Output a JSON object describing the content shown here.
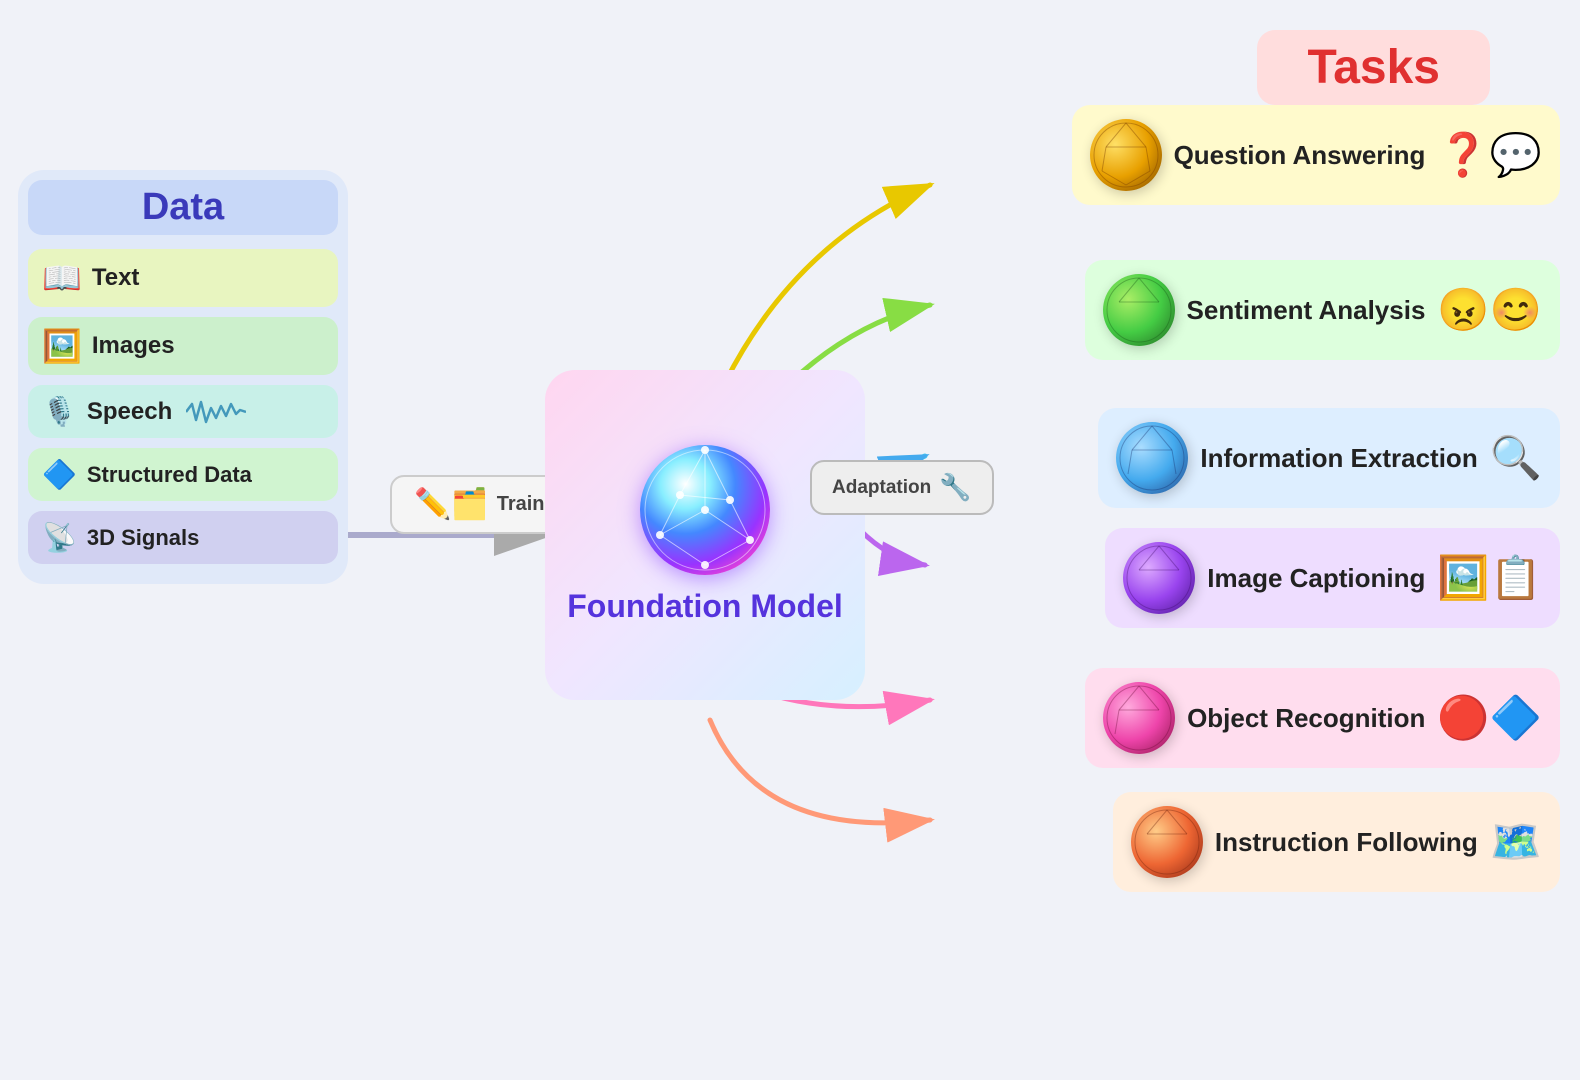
{
  "data_section": {
    "title": "Data",
    "items": [
      {
        "id": "text",
        "label": "Text",
        "emoji": "📖",
        "color": "text-item"
      },
      {
        "id": "images",
        "label": "Images",
        "emoji": "🖼️",
        "color": "images-item"
      },
      {
        "id": "speech",
        "label": "Speech",
        "emoji": "🎤",
        "color": "speech-item"
      },
      {
        "id": "structured",
        "label": "Structured Data",
        "emoji": "🔷",
        "color": "struct-item"
      },
      {
        "id": "signals",
        "label": "3D Signals",
        "emoji": "📡",
        "color": "signals-item"
      }
    ]
  },
  "training": {
    "label": "Training",
    "emoji": "✏️"
  },
  "foundation": {
    "title": "Foundation Model"
  },
  "adaptation": {
    "label": "Adaptation",
    "emoji": "🔧"
  },
  "tasks": {
    "header": "Tasks",
    "cards": [
      {
        "id": "qa",
        "label": "Question Answering",
        "ball": "gold",
        "icon": "💬",
        "card_class": "card-qa"
      },
      {
        "id": "sentiment",
        "label": "Sentiment Analysis",
        "ball": "green",
        "icon": "😊",
        "card_class": "card-sentiment"
      },
      {
        "id": "info",
        "label": "Information Extraction",
        "ball": "blue",
        "icon": "🔍",
        "card_class": "card-info"
      },
      {
        "id": "captioning",
        "label": "Image Captioning",
        "ball": "purple",
        "icon": "🖼️",
        "card_class": "card-captioning"
      },
      {
        "id": "object",
        "label": "Object Recognition",
        "ball": "pink",
        "icon": "🔴",
        "card_class": "card-object"
      },
      {
        "id": "instruct",
        "label": "Instruction Following",
        "ball": "red-orange",
        "icon": "🗺️",
        "card_class": "card-instruct"
      }
    ]
  }
}
